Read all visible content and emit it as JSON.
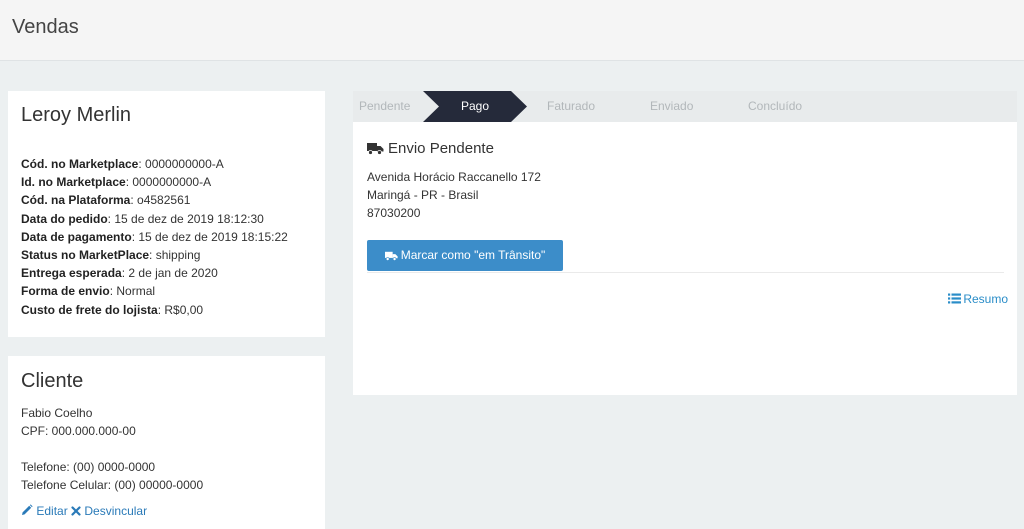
{
  "header": {
    "title": "Vendas"
  },
  "store": {
    "name": "Leroy Merlin",
    "fields": [
      {
        "label": "Cód. no Marketplace",
        "value": ": 0000000000-A"
      },
      {
        "label": "Id. no Marketplace",
        "value": ": 0000000000-A"
      },
      {
        "label": "Cód. na Plataforma",
        "value": ": o4582561"
      },
      {
        "label": "Data do pedido",
        "value": ": 15 de dez de 2019 18:12:30"
      },
      {
        "label": "Data de pagamento",
        "value": ": 15 de dez de 2019 18:15:22"
      },
      {
        "label": "Status no MarketPlace",
        "value": ": shipping"
      },
      {
        "label": "Entrega esperada",
        "value": ": 2 de jan de 2020"
      },
      {
        "label": "Forma de envio",
        "value": ": Normal"
      },
      {
        "label": "Custo de frete do lojista",
        "value": ": R$0,00"
      }
    ]
  },
  "client": {
    "title": "Cliente",
    "name": "Fabio Coelho",
    "cpf": "CPF: 000.000.000-00",
    "phone": "Telefone: (00) 0000-0000",
    "mobile": "Telefone Celular: (00) 00000-0000",
    "edit_label": "Editar",
    "unlink_label": "Desvincular"
  },
  "steps": {
    "items": [
      "Pendente",
      "Pago",
      "Faturado",
      "Enviado",
      "Concluído"
    ],
    "active_index": 1
  },
  "shipping": {
    "title": "Envio Pendente",
    "address_line1": "Avenida Horácio Raccanello 172",
    "address_line2": "Maringá - PR - Brasil",
    "zip": "87030200",
    "transit_button": "Marcar como \"em Trânsito\"",
    "summary_link": "Resumo"
  },
  "colors": {
    "accent": "#3c8dc9",
    "active_step": "#252a3a",
    "link": "#2a7ab8"
  },
  "icons": [
    "truck-icon",
    "pencil-icon",
    "times-icon",
    "list-icon"
  ]
}
